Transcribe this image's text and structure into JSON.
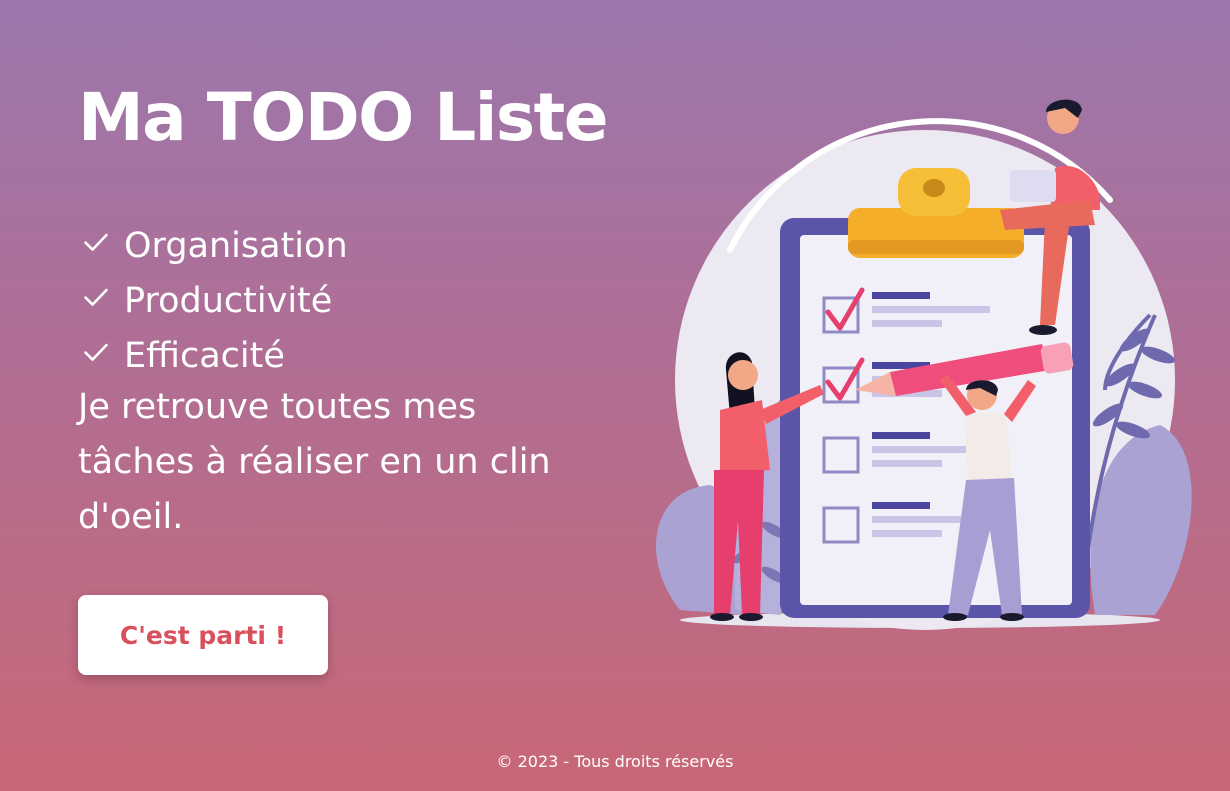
{
  "hero": {
    "title": "Ma TODO Liste",
    "features": [
      {
        "label": "Organisation",
        "icon": "check-icon"
      },
      {
        "label": "Productivité",
        "icon": "check-icon"
      },
      {
        "label": "Efficacité",
        "icon": "check-icon"
      }
    ],
    "description": "Je retrouve toutes mes tâches à réaliser en un clin d'oeil.",
    "cta_label": "C'est parti !"
  },
  "footer": {
    "copyright": "© 2023 - Tous droits réservés"
  },
  "colors": {
    "background_top": "#9b77ad",
    "background_bottom": "#c86876",
    "button_text": "#d8505c",
    "button_bg": "#ffffff"
  }
}
